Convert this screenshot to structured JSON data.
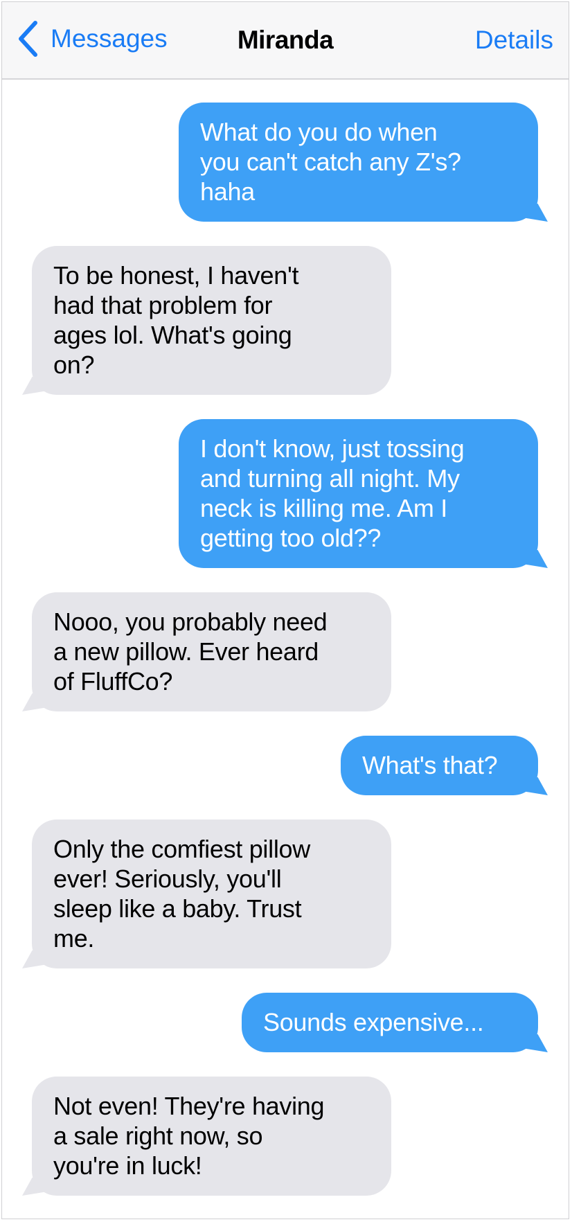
{
  "header": {
    "back_label": "Messages",
    "back_icon": "chevron-left-icon",
    "title": "Miranda",
    "details_label": "Details",
    "accent_color": "#1a7cf5"
  },
  "colors": {
    "outgoing": "#3ea0f6",
    "incoming": "#e5e5ea"
  },
  "messages": [
    {
      "direction": "outgoing",
      "text": "What do you do when\nyou can't catch any Z's?\nhaha"
    },
    {
      "direction": "incoming",
      "text": "To be honest, I haven't\nhad that problem for\nages lol. What's going\non?"
    },
    {
      "direction": "outgoing",
      "text": "I don't know, just tossing\nand turning all night. My\nneck is killing me. Am I\ngetting too old??"
    },
    {
      "direction": "incoming",
      "text": "Nooo, you probably need\na new pillow. Ever heard\nof FluffCo?"
    },
    {
      "direction": "outgoing",
      "text": "What's that?"
    },
    {
      "direction": "incoming",
      "text": "Only the comfiest pillow\never! Seriously, you'll\nsleep like a baby. Trust\nme."
    },
    {
      "direction": "outgoing",
      "text": "Sounds expensive..."
    },
    {
      "direction": "incoming",
      "text": "Not even! They're having\na sale right now, so\nyou're in luck!"
    }
  ]
}
